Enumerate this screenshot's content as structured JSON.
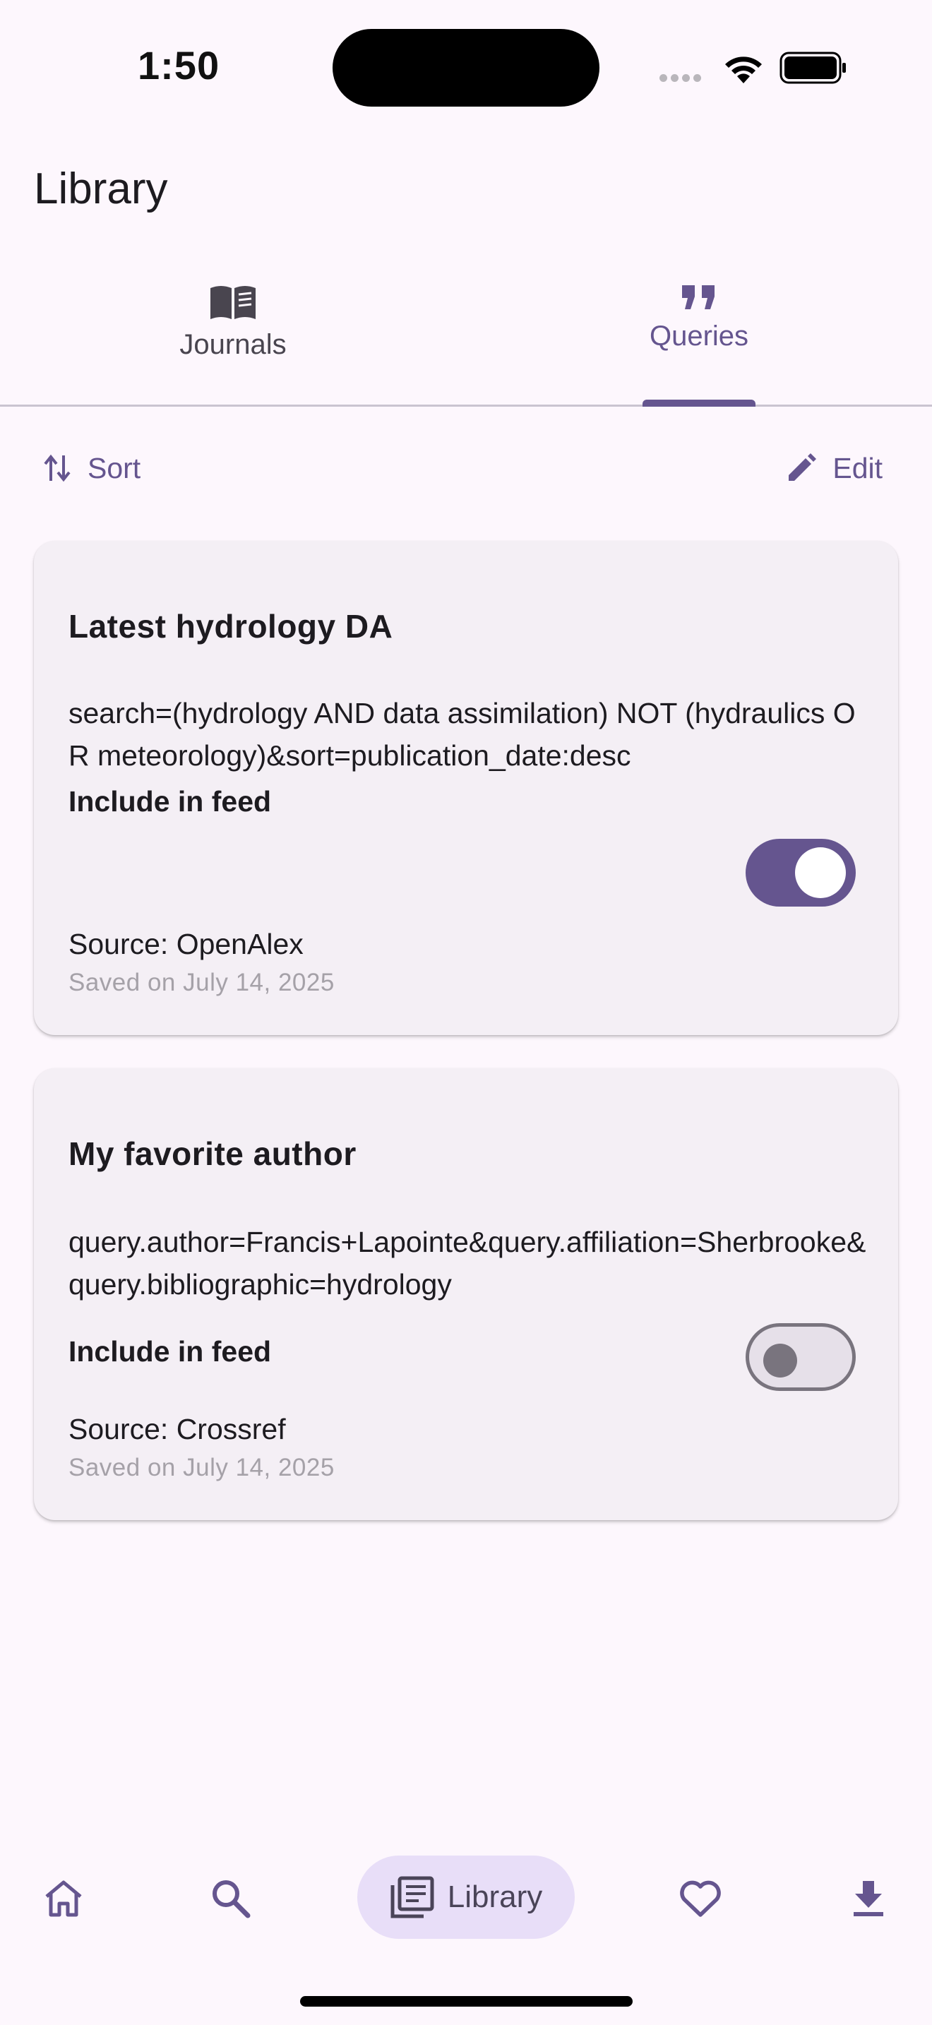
{
  "status_bar": {
    "time": "1:50"
  },
  "header": {
    "title": "Library"
  },
  "tabs": [
    {
      "label": "Journals",
      "icon": "book-icon",
      "selected": false
    },
    {
      "label": "Queries",
      "icon": "quote-icon",
      "selected": true
    }
  ],
  "actions": {
    "sort_label": "Sort",
    "edit_label": "Edit"
  },
  "queries": [
    {
      "title": "Latest hydrology DA",
      "query": "search=(hydrology AND data assimilation) NOT (hydraulics OR meteorology)&sort=publication_date:desc",
      "include_label": "Include in feed",
      "include_in_feed": true,
      "source": "Source: OpenAlex",
      "saved": "Saved on July 14, 2025"
    },
    {
      "title": "My favorite author",
      "query": "query.author=Francis+Lapointe&query.affiliation=Sherbrooke&query.bibliographic=hydrology",
      "include_label": "Include in feed",
      "include_in_feed": false,
      "source": "Source: Crossref",
      "saved": "Saved on July 14, 2025"
    }
  ],
  "bottom_nav": {
    "items": [
      {
        "icon": "home-icon",
        "selected": false
      },
      {
        "icon": "search-icon",
        "selected": false
      },
      {
        "icon": "library-icon",
        "label": "Library",
        "selected": true
      },
      {
        "icon": "heart-icon",
        "selected": false
      },
      {
        "icon": "download-icon",
        "selected": false
      }
    ]
  },
  "colors": {
    "accent": "#65558f",
    "background": "#fdf7fd",
    "card": "#f4eff5",
    "nav_pill": "#e8def8"
  }
}
